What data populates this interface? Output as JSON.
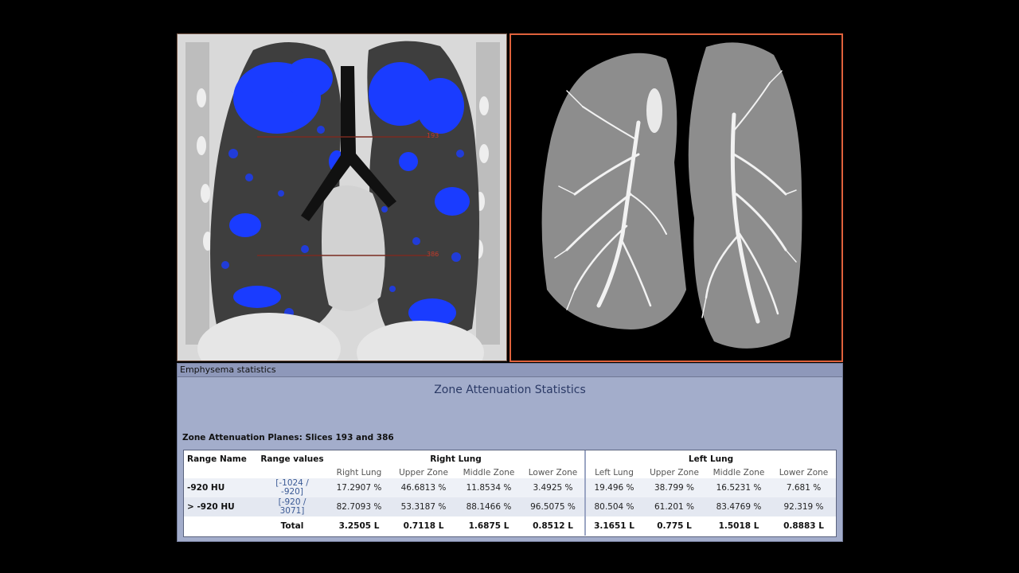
{
  "panel": {
    "header": "Emphysema statistics",
    "title": "Zone Attenuation Statistics",
    "planes_label": "Zone Attenuation Planes: Slices 193 and 386"
  },
  "coronal": {
    "plane_upper_label": "193",
    "plane_lower_label": "386"
  },
  "table": {
    "col_range_name": "Range Name",
    "col_range_values": "Range values",
    "group_right": "Right Lung",
    "group_left": "Left Lung",
    "sub": {
      "right_lung": "Right Lung",
      "upper": "Upper Zone",
      "middle": "Middle Zone",
      "lower": "Lower Zone",
      "left_lung": "Left Lung",
      "left_upper": "Upper Zone",
      "left_middle": "Middle Zone",
      "left_lower": "Lower Zone"
    },
    "rows": [
      {
        "name": "-920 HU",
        "range_a": "[-1024 /",
        "range_b": "-920]",
        "right_lung": "17.2907 %",
        "right_upper": "46.6813 %",
        "right_middle": "11.8534 %",
        "right_lower": "3.4925 %",
        "left_lung": "19.496 %",
        "left_upper": "38.799 %",
        "left_middle": "16.5231 %",
        "left_lower": "7.681 %"
      },
      {
        "name": "> -920 HU",
        "range_a": "[-920 /",
        "range_b": "3071]",
        "right_lung": "82.7093 %",
        "right_upper": "53.3187 %",
        "right_middle": "88.1466 %",
        "right_lower": "96.5075 %",
        "left_lung": "80.504 %",
        "left_upper": "61.201 %",
        "left_middle": "83.4769 %",
        "left_lower": "92.319 %"
      }
    ],
    "total": {
      "label": "Total",
      "right_lung": "3.2505 L",
      "right_upper": "0.7118 L",
      "right_middle": "1.6875 L",
      "right_lower": "0.8512 L",
      "left_lung": "3.1651 L",
      "left_upper": "0.775 L",
      "left_middle": "1.5018 L",
      "left_lower": "0.8883 L"
    }
  },
  "colors": {
    "emphysema_overlay": "#1a3cff",
    "viewport_3d_border": "#e0623c",
    "panel_bg": "#a3adcb",
    "title_color": "#2b3a66"
  }
}
